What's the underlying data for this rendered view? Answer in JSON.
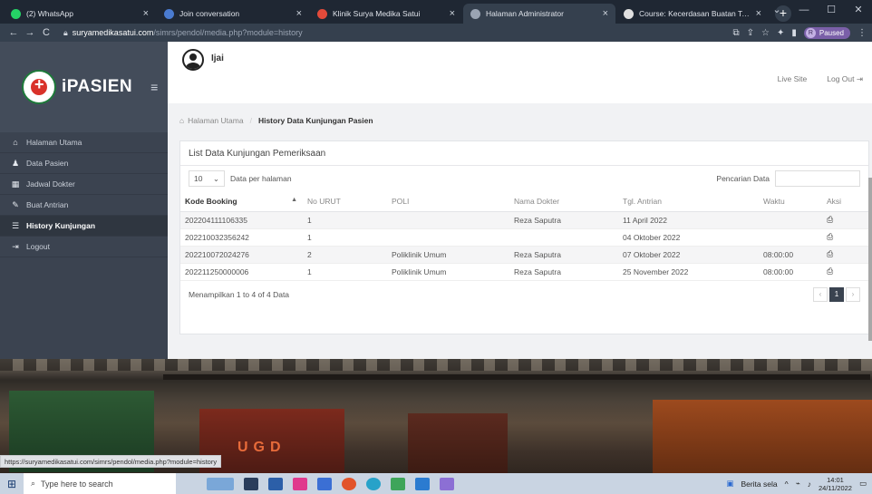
{
  "browser": {
    "tabs": [
      {
        "label": "(2) WhatsApp",
        "color": "#25d366"
      },
      {
        "label": "Join conversation",
        "color": "#4a7bd0"
      },
      {
        "label": "Klinik Surya Medika Satui",
        "color": "#e34a3a"
      },
      {
        "label": "Halaman Administrator",
        "color": "#9aa4b3",
        "active": true
      },
      {
        "label": "Course: Kecerdasan Buatan Terap",
        "color": "#e0e0e0"
      }
    ],
    "url_host": "suryamedikasatui.com",
    "url_path": "/simrs/pendol/media.php?module=history",
    "profile_initial": "R",
    "profile_status": "Paused"
  },
  "sidebar": {
    "brand": "iPASIEN",
    "items": [
      {
        "label": "Halaman Utama",
        "icon": "home-icon",
        "glyph": "⌂"
      },
      {
        "label": "Data Pasien",
        "icon": "user-icon",
        "glyph": "♟"
      },
      {
        "label": "Jadwal Dokter",
        "icon": "calendar-icon",
        "glyph": "▦"
      },
      {
        "label": "Buat Antrian",
        "icon": "pencil-icon",
        "glyph": "✎"
      },
      {
        "label": "History Kunjungan",
        "icon": "list-icon",
        "glyph": "☰",
        "active": true
      },
      {
        "label": "Logout",
        "icon": "logout-icon",
        "glyph": "⇥"
      }
    ]
  },
  "header": {
    "username": "Ijai",
    "live_site": "Live Site",
    "logout": "Log Out"
  },
  "breadcrumb": {
    "home": "Halaman Utama",
    "current": "History Data Kunjungan Pasien"
  },
  "panel": {
    "title": "List Data Kunjungan Pemeriksaan",
    "page_length": "10",
    "length_label": "Data per halaman",
    "search_label": "Pencarian Data",
    "columns": [
      "Kode Booking",
      "No URUT",
      "POLI",
      "Nama Dokter",
      "Tgl. Antrian",
      "Waktu",
      "Aksi"
    ],
    "rows": [
      [
        "202204111106335",
        "1",
        "",
        "Reza Saputra",
        "11 April 2022",
        ""
      ],
      [
        "202210032356242",
        "1",
        "",
        "",
        "04 Oktober 2022",
        ""
      ],
      [
        "202210072024276",
        "2",
        "Poliklinik Umum",
        "Reza Saputra",
        "07 Oktober 2022",
        "08:00:00"
      ],
      [
        "202211250000006",
        "1",
        "Poliklinik Umum",
        "Reza Saputra",
        "25 November 2022",
        "08:00:00"
      ]
    ],
    "info": "Menampilkan 1 to 4 of 4 Data",
    "pager": {
      "prev": "‹",
      "page": "1",
      "next": "›"
    }
  },
  "status_url": "https://suryamedikasatui.com/simrs/pendol/media.php?module=history",
  "taskbar": {
    "search_placeholder": "Type here to search",
    "news": "Berita sela",
    "time": "14:01",
    "date": "24/11/2022"
  }
}
